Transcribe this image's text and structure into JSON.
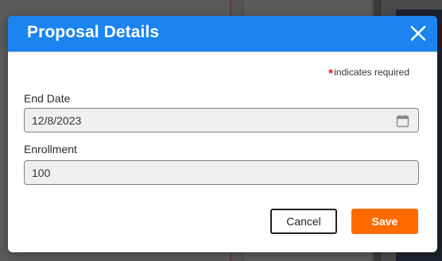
{
  "dialog": {
    "title": "Proposal Details",
    "required_note": "indicates required",
    "required_marker": "*",
    "header_color": "#1b84f0"
  },
  "fields": {
    "end_date": {
      "label": "End Date",
      "value": "12/8/2023",
      "icon": "calendar-icon"
    },
    "enrollment": {
      "label": "Enrollment",
      "value": "100"
    }
  },
  "actions": {
    "cancel_label": "Cancel",
    "save_label": "Save",
    "save_color": "#ff6a00"
  },
  "icons": {
    "close": "close-icon"
  }
}
